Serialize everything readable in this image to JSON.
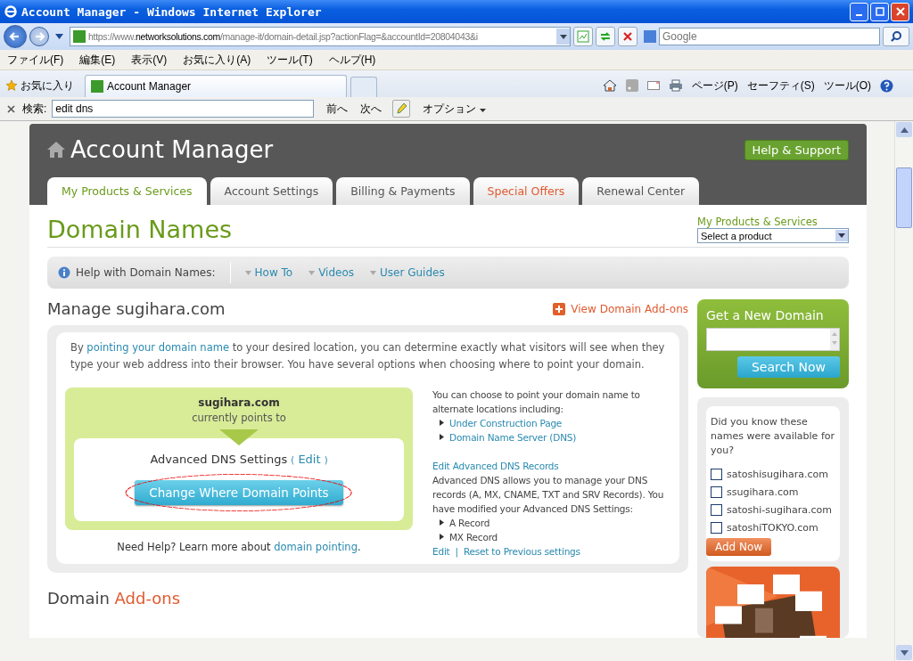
{
  "window": {
    "title": "Account Manager - Windows Internet Explorer"
  },
  "address_bar": {
    "url_host_prefix": "https://www.",
    "url_host": "networksolutions.com",
    "url_path": "/manage-it/domain-detail.jsp?actionFlag=&accountId=20804043&i",
    "search_placeholder": "Google"
  },
  "menu_bar": [
    "ファイル(F)",
    "編集(E)",
    "表示(V)",
    "お気に入り(A)",
    "ツール(T)",
    "ヘルプ(H)"
  ],
  "favorites": "お気に入り",
  "tabs": [
    {
      "label": "Account Manager",
      "selected": true
    }
  ],
  "command_bar": [
    "ページ(P)",
    "セーフティ(S)",
    "ツール(O)"
  ],
  "find_bar": {
    "label": "検索:",
    "value": "edit dns",
    "previous": "前へ",
    "next": "次へ",
    "options": "オプション"
  },
  "page": {
    "header": {
      "title": "Account Manager",
      "help_button": "Help & Support"
    },
    "nav_tabs": [
      {
        "label": "My Products & Services",
        "selected": true,
        "kind": "normal"
      },
      {
        "label": "Account Settings",
        "selected": false,
        "kind": "normal"
      },
      {
        "label": "Billing & Payments",
        "selected": false,
        "kind": "normal"
      },
      {
        "label": "Special Offers",
        "selected": false,
        "kind": "promo"
      },
      {
        "label": "Renewal Center",
        "selected": false,
        "kind": "normal"
      }
    ],
    "product_selector": {
      "label": "My Products & Services",
      "value": "Select a product"
    },
    "heading": "Domain Names",
    "help_bar": {
      "label": "Help with Domain Names:",
      "links": [
        "How To",
        "Videos",
        "User Guides"
      ]
    },
    "manage_title": "Manage sugihara.com",
    "addons_link": "View Domain Add-ons",
    "intro": {
      "before": "By ",
      "link": "pointing your domain name",
      "after": " to your desired location, you can determine exactly what visitors will see when they type your web address into their browser. You have several options when choosing where to point your domain."
    },
    "pointing": {
      "domain": "sugihara.com",
      "points_to": "currently points to",
      "settings_label": "Advanced DNS Settings",
      "open_paren": "(",
      "edit_link": "Edit",
      "close_paren": ")",
      "button": "Change Where Domain Points"
    },
    "need_help": {
      "text": "Need Help? Learn more about ",
      "link": "domain pointing",
      "end": "."
    },
    "options_text": "You can choose to point your domain name to alternate locations including:",
    "options": [
      "Under Construction Page",
      "Domain Name Server (DNS)"
    ],
    "edit_records_link": "Edit Advanced DNS Records",
    "dns_description": "Advanced DNS allows you to manage your DNS records (A, MX, CNAME, TXT and SRV Records). You have modified your Advanced DNS Settings:",
    "records": [
      "A Record",
      "MX Record"
    ],
    "edit_link": "Edit",
    "separator": "|",
    "reset_link": "Reset to Previous settings",
    "new_domain": {
      "title": "Get a New Domain",
      "button": "Search Now"
    },
    "suggestions": {
      "prompt": "Did you know these names were available for you?",
      "domains": [
        {
          "name": "satoshisugihara.com",
          "checked": false
        },
        {
          "name": "ssugihara.com",
          "checked": false
        },
        {
          "name": "satoshi-sugihara.com",
          "checked": false
        },
        {
          "name": "satoshiTOKYO.com",
          "checked": false
        }
      ],
      "button": "Add Now"
    },
    "promo": {
      "kind": "picture"
    },
    "addons_heading": {
      "first": "Domain",
      "second": "Add-ons"
    }
  }
}
